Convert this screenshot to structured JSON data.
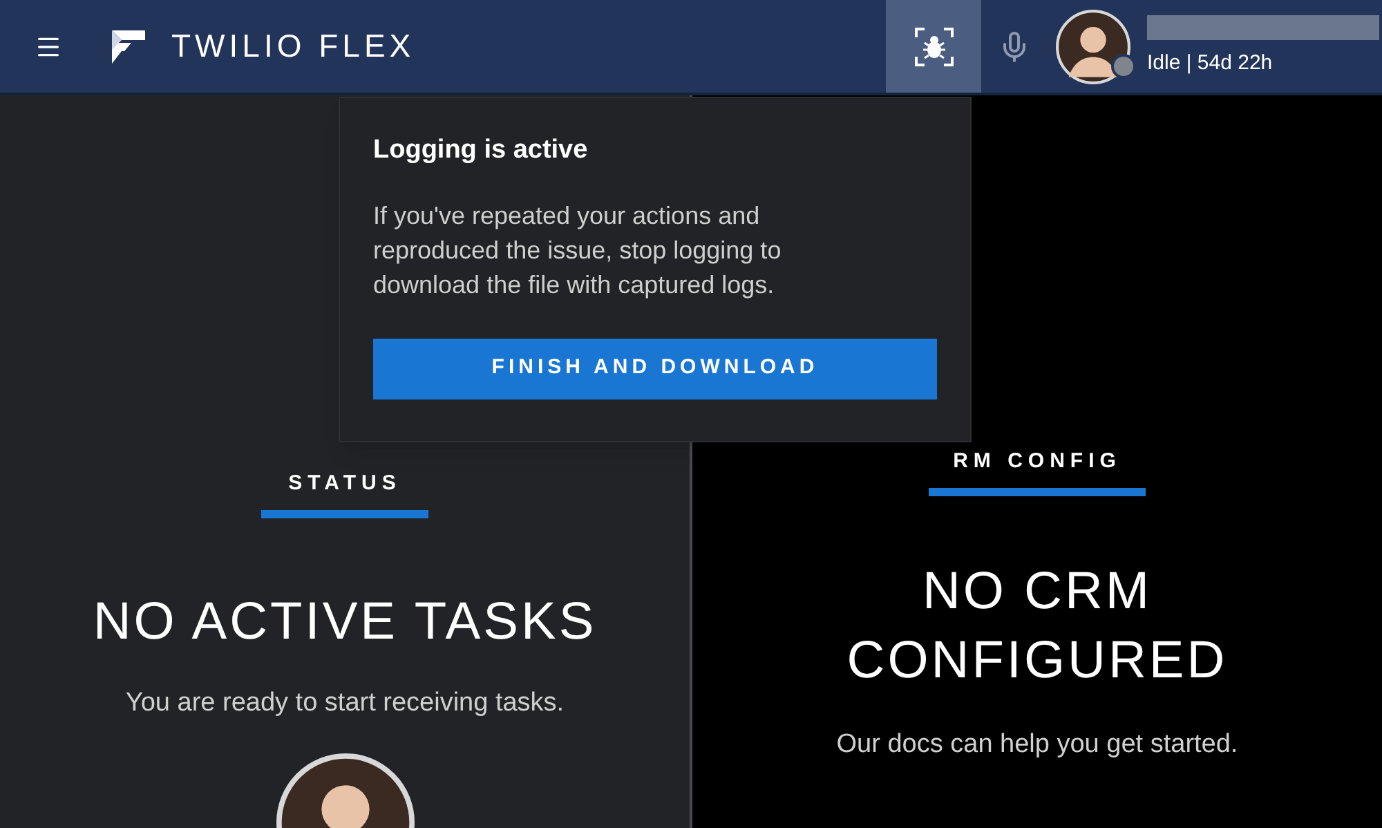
{
  "header": {
    "brand": "TWILIO FLEX",
    "logging_button": {
      "selected": true
    },
    "user": {
      "activity": "Idle | 54d 22h"
    }
  },
  "popover": {
    "title": "Logging is active",
    "body": "If you've repeated your actions and reproduced the issue, stop logging to download the file with captured logs.",
    "button": "FINISH AND DOWNLOAD"
  },
  "panels": [
    {
      "kind": "tasks",
      "tab": {
        "label": "STATUS",
        "selected": true
      },
      "heading": "NO ACTIVE TASKS",
      "text": "You are ready to start receiving tasks."
    },
    {
      "kind": "crm",
      "tab": {
        "label": "RM CONFIG",
        "selected": true
      },
      "heading": "NO CRM CONFIGURED",
      "text": "Our docs can help you get started."
    }
  ]
}
